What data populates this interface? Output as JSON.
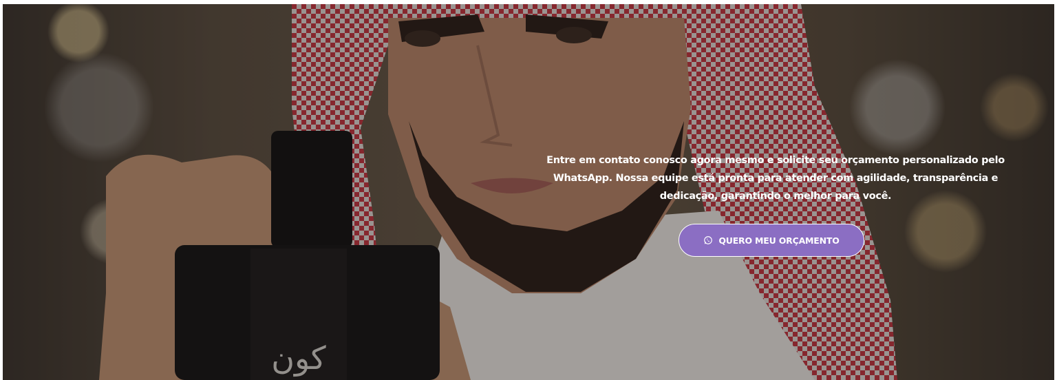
{
  "hero": {
    "description": "Entre em contato conosco agora mesmo e solicite seu orçamento personalizado pelo WhatsApp. Nossa equipe está pronta para atender com agilidade, transparência e dedicação, garantindo o melhor para você.",
    "bottle_text": "كون",
    "cta": {
      "label": "QUERO MEU ORÇAMENTO",
      "icon": "whatsapp-icon",
      "color": "#8b6ec3"
    }
  }
}
